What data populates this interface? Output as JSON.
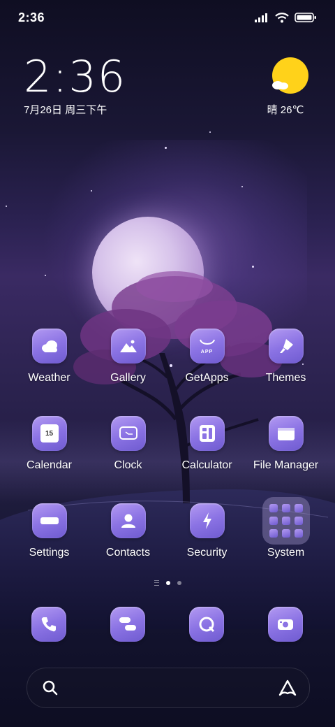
{
  "status_bar": {
    "time": "2:36"
  },
  "clock_widget": {
    "time": "2:36",
    "date": "7月26日 周三下午"
  },
  "weather_widget": {
    "text": "晴 26℃"
  },
  "apps": [
    {
      "label": "Weather",
      "icon": "cloud-icon"
    },
    {
      "label": "Gallery",
      "icon": "mountain-icon"
    },
    {
      "label": "GetApps",
      "icon": "shopping-bag-icon",
      "icon_text": "APP"
    },
    {
      "label": "Themes",
      "icon": "brush-icon"
    },
    {
      "label": "Calendar",
      "icon": "calendar-icon",
      "icon_text": "15"
    },
    {
      "label": "Clock",
      "icon": "clock-icon"
    },
    {
      "label": "Calculator",
      "icon": "calculator-icon"
    },
    {
      "label": "File Manager",
      "icon": "folder-icon"
    },
    {
      "label": "Settings",
      "icon": "settings-icon"
    },
    {
      "label": "Contacts",
      "icon": "person-icon"
    },
    {
      "label": "Security",
      "icon": "lightning-icon"
    },
    {
      "label": "System",
      "icon": "app-folder-icon"
    }
  ],
  "page_indicator": {
    "pages": 2,
    "current": 1
  },
  "dock": [
    {
      "name": "phone",
      "icon": "phone-icon"
    },
    {
      "name": "messages",
      "icon": "message-icon"
    },
    {
      "name": "browser",
      "icon": "browser-icon"
    },
    {
      "name": "camera",
      "icon": "camera-icon"
    }
  ],
  "colors": {
    "icon_accent": "#8b73e4",
    "sun": "#ffd21a"
  }
}
